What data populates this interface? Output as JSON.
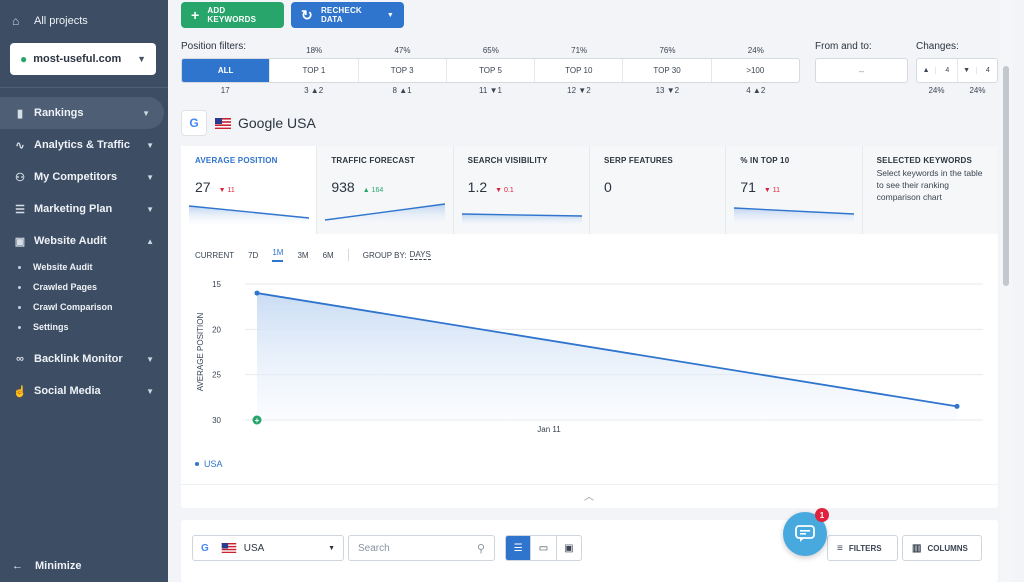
{
  "sidebar": {
    "all_projects": "All projects",
    "project": "most-useful.com",
    "items": [
      {
        "label": "Rankings",
        "icon": "bar-chart-icon"
      },
      {
        "label": "Analytics & Traffic",
        "icon": "pulse-icon"
      },
      {
        "label": "My Competitors",
        "icon": "users-icon"
      },
      {
        "label": "Marketing Plan",
        "icon": "checklist-icon"
      },
      {
        "label": "Website Audit",
        "icon": "audit-icon"
      },
      {
        "label": "Backlink Monitor",
        "icon": "link-icon"
      },
      {
        "label": "Social Media",
        "icon": "thumbs-up-icon"
      }
    ],
    "sub_items": [
      "Website Audit",
      "Crawled Pages",
      "Crawl Comparison",
      "Settings"
    ],
    "minimize": "Minimize"
  },
  "toolbar": {
    "add_keywords": "ADD KEYWORDS",
    "recheck_data": "RECHECK DATA"
  },
  "position_filters": {
    "label": "Position filters:",
    "tabs": [
      {
        "label": "ALL",
        "pct": "",
        "count": "17",
        "delta": "",
        "dir": ""
      },
      {
        "label": "TOP 1",
        "pct": "18%",
        "count": "3",
        "delta": "2",
        "dir": "up"
      },
      {
        "label": "TOP 3",
        "pct": "47%",
        "count": "8",
        "delta": "1",
        "dir": "up"
      },
      {
        "label": "TOP 5",
        "pct": "65%",
        "count": "11",
        "delta": "1",
        "dir": "down"
      },
      {
        "label": "TOP 10",
        "pct": "71%",
        "count": "12",
        "delta": "2",
        "dir": "down"
      },
      {
        "label": "TOP 30",
        "pct": "76%",
        "count": "13",
        "delta": "2",
        "dir": "down"
      },
      {
        "label": ">100",
        "pct": "24%",
        "count": "4",
        "delta": "2",
        "dir": "up"
      }
    ]
  },
  "from_to": {
    "label": "From and to:",
    "value": "–"
  },
  "changes": {
    "label": "Changes:",
    "up_value": "4",
    "down_value": "4",
    "up_pct": "24%",
    "down_pct": "24%"
  },
  "engine": {
    "badge": "G",
    "name": "Google USA"
  },
  "metrics": [
    {
      "title": "AVERAGE POSITION",
      "value": "27",
      "delta": "11",
      "dir": "down"
    },
    {
      "title": "TRAFFIC FORECAST",
      "value": "938",
      "delta": "164",
      "dir": "up"
    },
    {
      "title": "SEARCH VISIBILITY",
      "value": "1.2",
      "delta": "0.1",
      "dir": "down"
    },
    {
      "title": "SERP FEATURES",
      "value": "0",
      "delta": "",
      "dir": ""
    },
    {
      "title": "% IN TOP 10",
      "value": "71",
      "delta": "11",
      "dir": "down"
    },
    {
      "title": "SELECTED KEYWORDS",
      "desc": "Select keywords in the table to see their ranking comparison chart"
    }
  ],
  "range": {
    "options": [
      "CURRENT",
      "7D",
      "1M",
      "3M",
      "6M"
    ],
    "selected": "1M",
    "group_by_label": "GROUP BY:",
    "group_by_value": "DAYS"
  },
  "chart_data": {
    "type": "line",
    "ylabel": "AVERAGE POSITION",
    "y_inverted": true,
    "ylim": [
      15,
      30
    ],
    "yticks": [
      "15",
      "20",
      "25",
      "30"
    ],
    "x_tick_label": "Jan 11",
    "series": [
      {
        "name": "USA",
        "values": [
          16,
          28.5
        ]
      }
    ]
  },
  "bottom": {
    "country": "USA",
    "search_placeholder": "Search",
    "filters": "FILTERS",
    "columns": "COLUMNS"
  },
  "chat": {
    "badge": "1"
  },
  "colors": {
    "accent": "#2f74cd",
    "success": "#27a56b",
    "danger": "#e0223d",
    "sidebar": "#3d4d63"
  }
}
